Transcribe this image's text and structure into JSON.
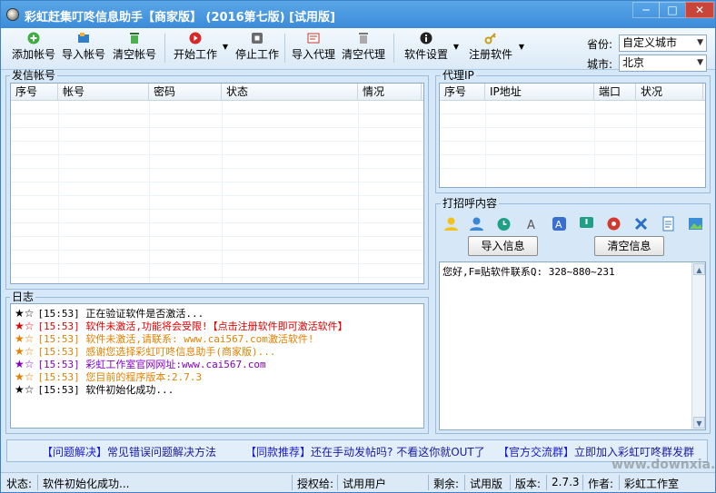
{
  "window": {
    "title": "彩虹赶集叮咚信息助手【商家版】 (2016第七版) [试用版]",
    "min": "─",
    "max": "□",
    "close": "✕"
  },
  "toolbar": {
    "add_account": "添加帐号",
    "import_account": "导入帐号",
    "clear_account": "清空帐号",
    "start_work": "开始工作",
    "stop_work": "停止工作",
    "import_proxy": "导入代理",
    "clear_proxy": "清空代理",
    "settings": "软件设置",
    "register": "注册软件",
    "province_label": "省份:",
    "province_value": "自定义城市",
    "city_label": "城市:",
    "city_value": "北京"
  },
  "accounts": {
    "group_label": "发信帐号",
    "columns": [
      "序号",
      "帐号",
      "密码",
      "状态",
      "情况"
    ]
  },
  "proxy": {
    "group_label": "代理IP",
    "columns": [
      "序号",
      "IP地址",
      "端口",
      "状况"
    ]
  },
  "greeting": {
    "group_label": "打招呼内容",
    "import_btn": "导入信息",
    "clear_btn": "清空信息",
    "content": "您好,F≡贴软件联系Q: 328~880~231"
  },
  "log": {
    "group_label": "日志",
    "entries": [
      {
        "time": "[15:53]",
        "text": "正在验证软件是否激活...",
        "color": "#000000",
        "star": "#000000"
      },
      {
        "time": "[15:53]",
        "text": "软件未激活,功能将会受限!【点击注册软件即可激活软件】",
        "color": "#e00000",
        "star": "#e00000"
      },
      {
        "time": "[15:53]",
        "text": "软件未激活,请联系: www.cai567.com激活软件!",
        "color": "#e08000",
        "star": "#e08000"
      },
      {
        "time": "[15:53]",
        "text": "感谢您选择彩虹叮咚信息助手(商家版)...",
        "color": "#e08000",
        "star": "#e08000"
      },
      {
        "time": "[15:53]",
        "text": "彩虹工作室官网网址:www.cai567.com",
        "color": "#8000c0",
        "star": "#8000c0"
      },
      {
        "time": "[15:53]",
        "text": "您目前的程序版本:2.7.3",
        "color": "#e08000",
        "star": "#e08000"
      },
      {
        "time": "[15:53]",
        "text": "软件初始化成功...",
        "color": "#000000",
        "star": "#000000"
      }
    ]
  },
  "links": {
    "l1_tag": "【问题解决】",
    "l1_text": "常见错误问题解决方法",
    "l2_tag": "【同款推荐】",
    "l2_text": "还在手动发帖吗? 不看这你就OUT了",
    "l3_tag": "【官方交流群】",
    "l3_text": "立即加入彩虹叮咚群发群"
  },
  "status": {
    "state_label": "状态:",
    "state_value": "软件初始化成功...",
    "auth_label": "授权给:",
    "auth_value": "试用用户",
    "remain_label": "剩余:",
    "remain_value": "试用版",
    "version_label": "版本:",
    "version_value": "2.7.3",
    "author_label": "作者:",
    "author_value": "彩虹工作室"
  },
  "watermark": "www.downxia.com",
  "icons": [
    "add-icon",
    "import-icon",
    "trash-icon",
    "play-icon",
    "stop-icon",
    "proxy-import-icon",
    "proxy-clear-icon",
    "settings-icon",
    "key-icon"
  ]
}
